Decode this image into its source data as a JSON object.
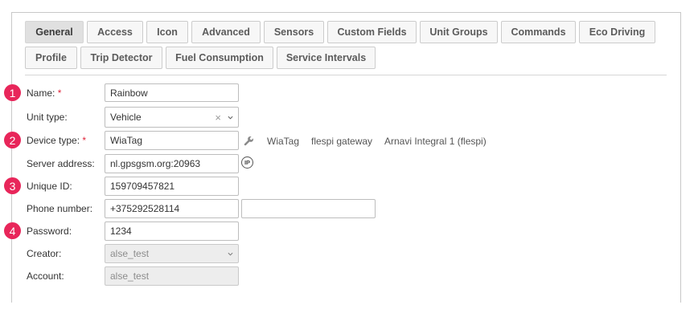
{
  "tabs": [
    {
      "label": "General",
      "active": true
    },
    {
      "label": "Access"
    },
    {
      "label": "Icon"
    },
    {
      "label": "Advanced"
    },
    {
      "label": "Sensors"
    },
    {
      "label": "Custom Fields"
    },
    {
      "label": "Unit Groups"
    },
    {
      "label": "Commands"
    },
    {
      "label": "Eco Driving"
    },
    {
      "label": "Profile"
    },
    {
      "label": "Trip Detector"
    },
    {
      "label": "Fuel Consumption"
    },
    {
      "label": "Service Intervals"
    }
  ],
  "markers": [
    "1",
    "2",
    "3",
    "4"
  ],
  "form": {
    "required_mark": "*",
    "name": {
      "label": "Name:",
      "value": "Rainbow"
    },
    "unit_type": {
      "label": "Unit type:",
      "value": "Vehicle",
      "clear": "×"
    },
    "device_type": {
      "label": "Device type:",
      "value": "WiaTag",
      "options": [
        "WiaTag",
        "flespi gateway",
        "Arnavi Integral 1 (flespi)"
      ]
    },
    "server_address": {
      "label": "Server address:",
      "value": "nl.gpsgsm.org:20963",
      "ip_icon": "IP"
    },
    "unique_id": {
      "label": "Unique ID:",
      "value": "159709457821"
    },
    "phone": {
      "label": "Phone number:",
      "value": "+375292528114",
      "second_value": ""
    },
    "password": {
      "label": "Password:",
      "value": "1234"
    },
    "creator": {
      "label": "Creator:",
      "value": "alse_test"
    },
    "account": {
      "label": "Account:",
      "value": "alse_test"
    }
  },
  "colors": {
    "marker": "#e8265a",
    "required": "#e0243a",
    "active_tab": "#e0e0e0"
  },
  "icons": [
    "wrench-icon",
    "ip-icon",
    "chevron-down-icon",
    "clear-icon"
  ]
}
